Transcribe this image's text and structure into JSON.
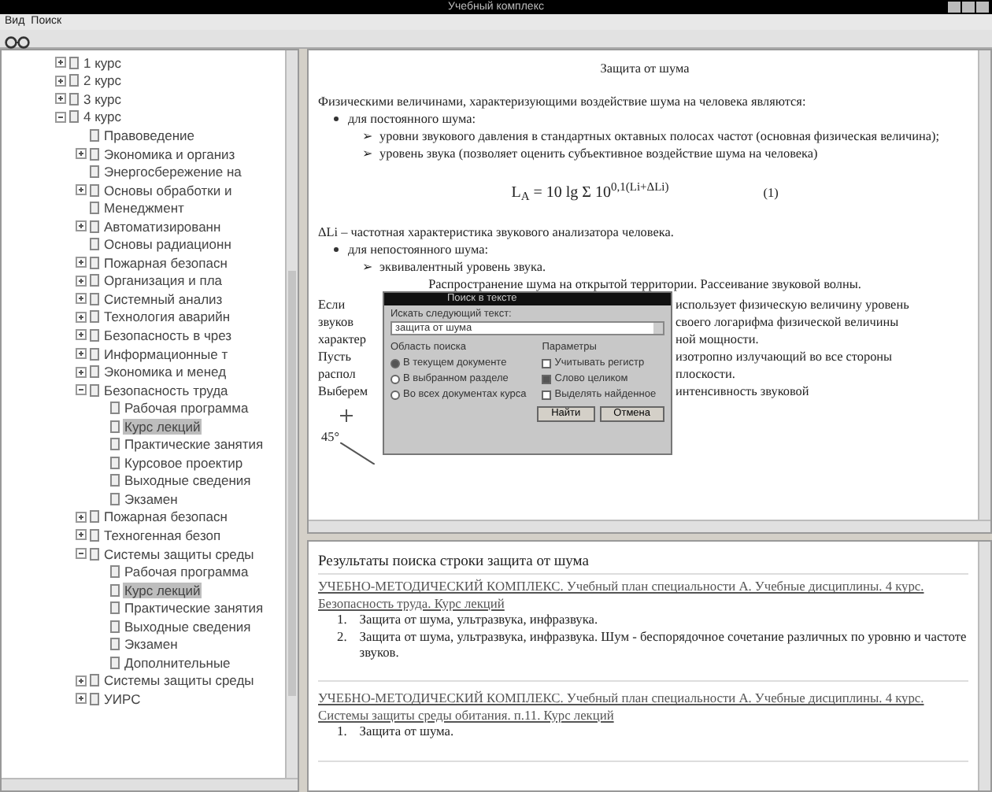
{
  "window": {
    "title": "Учебный комплекс"
  },
  "menu": [
    "Вид",
    "Поиск"
  ],
  "tree": [
    {
      "label": "1 курс",
      "kind": "folder",
      "expanded": false,
      "selected": false
    },
    {
      "label": "2 курс",
      "kind": "folder",
      "expanded": false,
      "selected": false
    },
    {
      "label": "3 курс",
      "kind": "folder",
      "expanded": false,
      "selected": false
    },
    {
      "label": "4 курс",
      "kind": "folder",
      "expanded": true,
      "selected": false,
      "children": [
        {
          "label": "Правоведение",
          "kind": "leaf",
          "selected": false
        },
        {
          "label": "Экономика и организ",
          "kind": "folder",
          "expanded": false,
          "selected": false
        },
        {
          "label": "Энергосбережение на",
          "kind": "leaf",
          "selected": false
        },
        {
          "label": "Основы обработки и",
          "kind": "folder",
          "expanded": false,
          "selected": false
        },
        {
          "label": "Менеджмент",
          "kind": "leaf",
          "selected": false
        },
        {
          "label": "Автоматизированн",
          "kind": "folder",
          "expanded": false,
          "selected": false
        },
        {
          "label": "Основы радиационн",
          "kind": "leaf",
          "selected": false
        },
        {
          "label": "Пожарная безопасн",
          "kind": "folder",
          "expanded": false,
          "selected": false
        },
        {
          "label": "Организация и пла",
          "kind": "folder",
          "expanded": false,
          "selected": false
        },
        {
          "label": "Системный анализ",
          "kind": "folder",
          "expanded": false,
          "selected": false
        },
        {
          "label": "Технология аварийн",
          "kind": "folder",
          "expanded": false,
          "selected": false
        },
        {
          "label": "Безопасность в чрез",
          "kind": "folder",
          "expanded": false,
          "selected": false
        },
        {
          "label": "Информационные т",
          "kind": "folder",
          "expanded": false,
          "selected": false
        },
        {
          "label": "Экономика и менед",
          "kind": "folder",
          "expanded": false,
          "selected": false
        },
        {
          "label": "Безопасность труда",
          "kind": "folder",
          "expanded": true,
          "selected": false,
          "children": [
            {
              "label": "Рабочая программа",
              "kind": "leaf",
              "selected": false
            },
            {
              "label": "Курс лекций",
              "kind": "leaf",
              "selected": true
            },
            {
              "label": "Практические занятия",
              "kind": "leaf",
              "selected": false
            },
            {
              "label": "Курсовое проектир",
              "kind": "leaf",
              "selected": false
            },
            {
              "label": "Выходные сведения",
              "kind": "leaf",
              "selected": false
            },
            {
              "label": "Экзамен",
              "kind": "leaf",
              "selected": false
            }
          ]
        },
        {
          "label": "Пожарная безопасн",
          "kind": "folder",
          "expanded": false,
          "selected": false
        },
        {
          "label": "Техногенная безоп",
          "kind": "folder",
          "expanded": false,
          "selected": false
        },
        {
          "label": "Системы защиты среды",
          "kind": "folder",
          "expanded": true,
          "selected": false,
          "children": [
            {
              "label": "Рабочая программа",
              "kind": "leaf",
              "selected": false
            },
            {
              "label": "Курс лекций",
              "kind": "leaf",
              "selected": true
            },
            {
              "label": "Практические занятия",
              "kind": "leaf",
              "selected": false
            },
            {
              "label": "Выходные сведения",
              "kind": "leaf",
              "selected": false
            },
            {
              "label": "Экзамен",
              "kind": "leaf",
              "selected": false
            },
            {
              "label": "Дополнительные",
              "kind": "leaf",
              "selected": false
            }
          ]
        },
        {
          "label": "Системы защиты среды",
          "kind": "folder",
          "expanded": false,
          "selected": false
        },
        {
          "label": "УИРС",
          "kind": "folder",
          "expanded": false,
          "selected": false
        }
      ]
    }
  ],
  "document": {
    "heading": "Защита от шума",
    "blocks": [
      {
        "kind": "para",
        "text": "Физическими величинами, характеризующими воздействие шума на человека являются:"
      },
      {
        "kind": "bullet",
        "text": "для постоянного шума:"
      },
      {
        "kind": "sub",
        "marker": "➢",
        "text": "уровни звукового давления в стандартных октавных полосах частот (основная физическая величина);"
      },
      {
        "kind": "sub",
        "marker": "➢",
        "text": "уровень звука (позволяет оценить субъективное воздействие шума на человека)"
      },
      {
        "kind": "formula",
        "text": "L$_{A}$ = 10 lg Σ 10$^{0,1(Li+ΔLi)}$",
        "number": "(1)"
      },
      {
        "kind": "para",
        "text": "ΔLi – частотная характеристика звукового анализатора человека."
      },
      {
        "kind": "bullet",
        "text": "для непостоянного шума:"
      },
      {
        "kind": "sub",
        "marker": "➢",
        "text": "эквивалентный уровень звука."
      },
      {
        "kind": "center",
        "text": "Распространение шума на открытой территории. Рассеивание звуковой волны."
      }
    ],
    "hidden_lines": [
      {
        "left": "Если",
        "right": "использует физическую величину уровень"
      },
      {
        "left": "звуков",
        "right": "своего логарифма физической величины"
      },
      {
        "left": "характер",
        "right": "ной мощности."
      },
      {
        "left": "Пусть",
        "right": "изотропно излучающий во все стороны"
      },
      {
        "left": "распол",
        "right": "плоскости."
      },
      {
        "left": "Выберем",
        "right": "интенсивность звуковой"
      }
    ],
    "angle_label": "45°"
  },
  "dialog": {
    "title": "Поиск в тексте",
    "field_label": "Искать следующий текст:",
    "value": "защита от шума",
    "scope_title": "Область поиска",
    "scope": [
      {
        "label": "В текущем документе",
        "selected": true
      },
      {
        "label": "В выбранном разделе",
        "selected": false
      },
      {
        "label": "Во всех документах курса",
        "selected": false
      }
    ],
    "options_title": "Параметры",
    "options": [
      {
        "label": "Учитывать регистр",
        "checked": false
      },
      {
        "label": "Слово целиком",
        "checked": true
      },
      {
        "label": "Выделять найденное",
        "checked": false
      }
    ],
    "buttons": [
      "Найти",
      "Отмена"
    ]
  },
  "results": {
    "heading": "Результаты поиска строки защита от шума",
    "groups": [
      {
        "link": "УЧЕБНО-МЕТОДИЧЕСКИЙ КОМПЛЕКС. Учебный план специальности А. Учебные дисциплины. 4 курс. Безопасность труда. Курс лекций",
        "items": [
          {
            "number": "1.",
            "text": "Защита от шума, ультразвука, инфразвука."
          },
          {
            "number": "2.",
            "text": "Защита от шума, ультразвука, инфразвука. Шум - беспорядочное сочетание различных по уровню и частоте звуков."
          }
        ]
      },
      {
        "link": "УЧЕБНО-МЕТОДИЧЕСКИЙ КОМПЛЕКС. Учебный план специальности А. Учебные дисциплины. 4 курс. Системы защиты среды обитания. п.11. Курс лекций",
        "items": [
          {
            "number": "1.",
            "text": "Защита от шума."
          }
        ]
      }
    ]
  }
}
